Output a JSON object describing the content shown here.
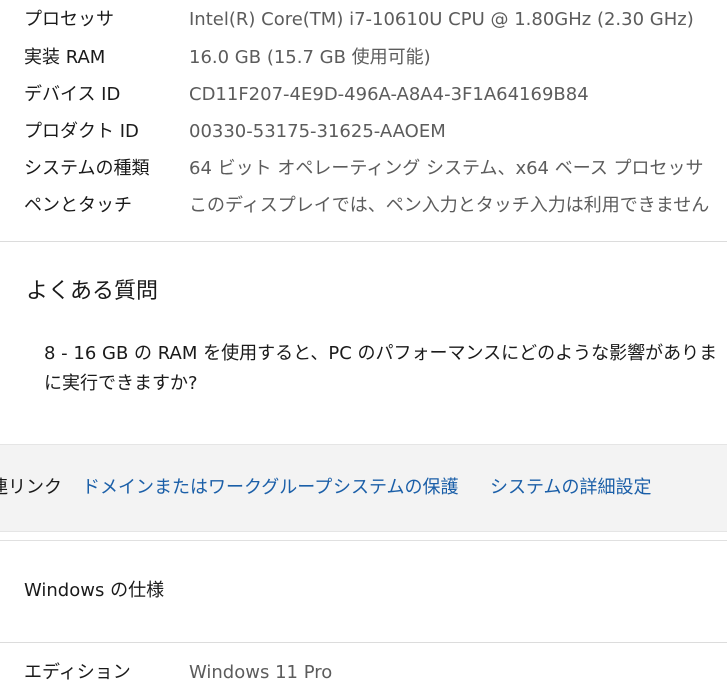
{
  "specs": {
    "rows": [
      {
        "label": "プロセッサ",
        "value": "Intel(R) Core(TM) i7-10610U CPU @ 1.80GHz (2.30 GHz)"
      },
      {
        "label": "実装 RAM",
        "value": "16.0 GB (15.7 GB 使用可能)"
      },
      {
        "label": "デバイス ID",
        "value": "CD11F207-4E9D-496A-A8A4-3F1A64169B84"
      },
      {
        "label": "プロダクト ID",
        "value": "00330-53175-31625-AAOEM"
      },
      {
        "label": "システムの種類",
        "value": "64 ビット オペレーティング システム、x64 ベース プロセッサ"
      },
      {
        "label": "ペンとタッチ",
        "value": "このディスプレイでは、ペン入力とタッチ入力は利用できません"
      }
    ]
  },
  "faq": {
    "heading": "よくある質問",
    "question_line1": "8 - 16 GB の RAM を使用すると、PC のパフォーマンスにどのような影響がありま",
    "question_line2": "に実行できますか?"
  },
  "related_links": {
    "label": "連リンク",
    "links": [
      "ドメインまたはワークグループ",
      "システムの保護",
      "システムの詳細設定"
    ]
  },
  "windows_spec": {
    "title": "Windows の仕様",
    "rows": [
      {
        "label": "エディション",
        "value": "Windows 11 Pro"
      }
    ]
  },
  "colors": {
    "link": "#1b5fa8",
    "value_text": "#5c5c5c",
    "links_bar_bg": "#f3f3f3"
  }
}
